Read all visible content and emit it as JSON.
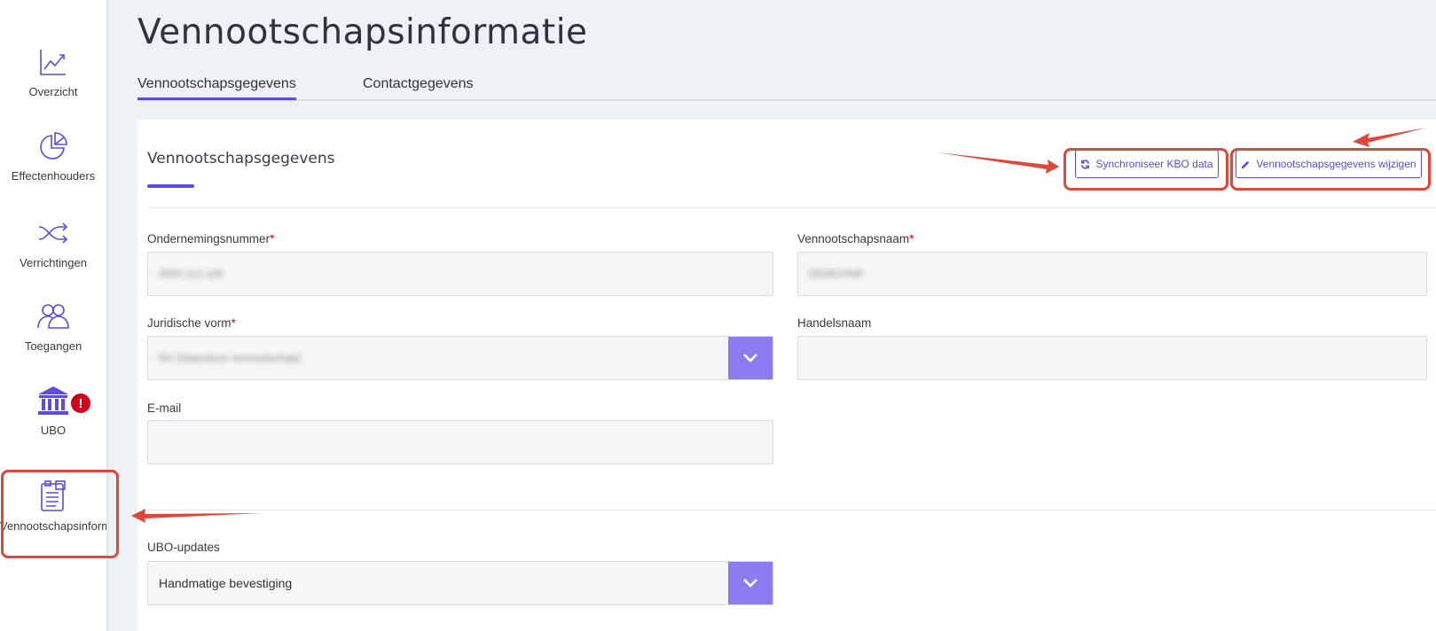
{
  "sidebar": {
    "items": [
      {
        "label": "Overzicht",
        "icon": "chart-line-icon"
      },
      {
        "label": "Effectenhouders",
        "icon": "pie-chart-icon"
      },
      {
        "label": "Verrichtingen",
        "icon": "shuffle-icon"
      },
      {
        "label": "Toegangen",
        "icon": "users-icon"
      },
      {
        "label": "UBO",
        "icon": "bank-icon",
        "badge": "!"
      },
      {
        "label": "Vennootschapsinformatie",
        "icon": "clipboard-icon"
      }
    ]
  },
  "header": {
    "title": "Vennootschapsinformatie",
    "tabs": [
      {
        "label": "Vennootschapsgegevens",
        "active": true
      },
      {
        "label": "Contactgegevens",
        "active": false
      }
    ]
  },
  "card": {
    "title": "Vennootschapsgegevens",
    "sync_button": "Synchroniseer KBO data",
    "edit_button": "Vennootschapsgegevens wijzigen",
    "fields": {
      "ondernemingsnummer": {
        "label": "Ondernemingsnummer",
        "required": "*",
        "value": "0000.112.106"
      },
      "vennootschapsnaam": {
        "label": "Vennootschapsnaam",
        "required": "*",
        "value": "DEMOVNR"
      },
      "juridische_vorm": {
        "label": "Juridische vorm",
        "required": "*",
        "value": "NV (Naamloze vennootschap)"
      },
      "handelsnaam": {
        "label": "Handelsnaam",
        "value": ""
      },
      "email": {
        "label": "E-mail",
        "value": ""
      },
      "ubo_updates": {
        "label": "UBO-updates",
        "value": "Handmatige bevestiging"
      }
    }
  },
  "colors": {
    "accent": "#5b4be0",
    "select_button": "#8b7cf2",
    "annotation": "#e0463a",
    "required": "#d0021b"
  }
}
